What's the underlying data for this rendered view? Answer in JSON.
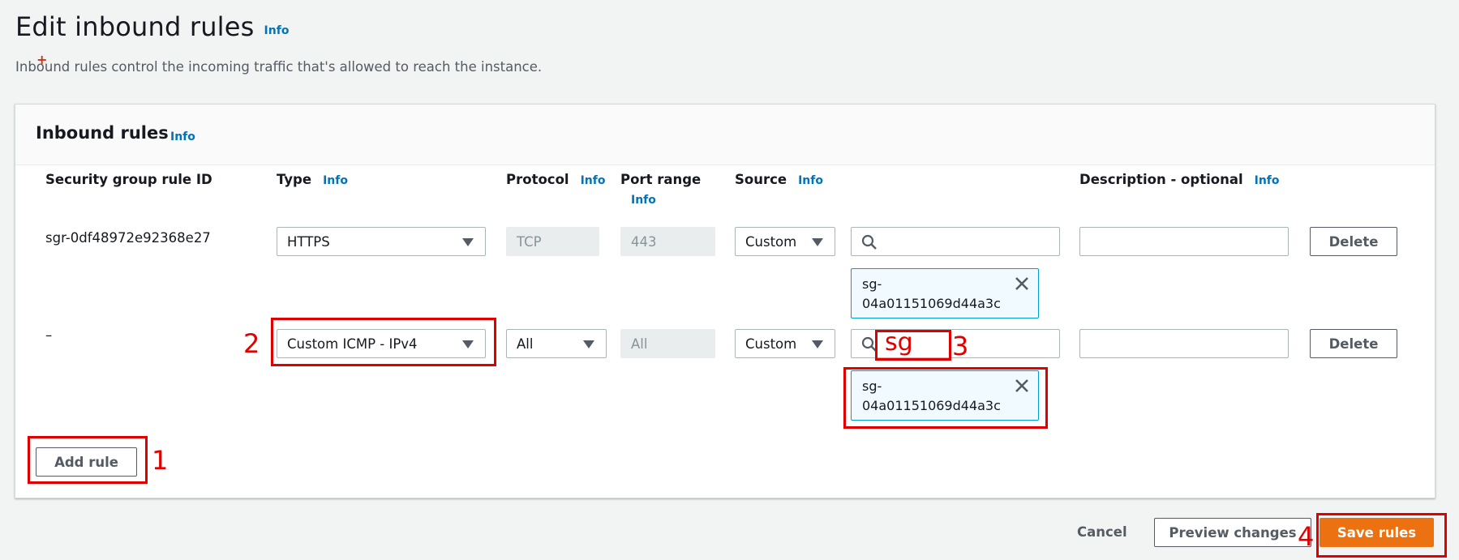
{
  "header": {
    "title": "Edit inbound rules",
    "info": "Info",
    "description": "Inbound rules control the incoming traffic that's allowed to reach the instance.",
    "desc_mark": "+"
  },
  "panel": {
    "title": "Inbound rules",
    "info": "Info",
    "columns": {
      "rule_id": "Security group rule ID",
      "type": "Type",
      "protocol": "Protocol",
      "port_range": "Port range",
      "source": "Source",
      "description": "Description - optional",
      "info": "Info"
    },
    "rows": [
      {
        "rule_id": "sgr-0df48972e92368e27",
        "type": "HTTPS",
        "protocol": "TCP",
        "port_range": "443",
        "source": "Custom",
        "search_value": "",
        "token_line1": "sg-",
        "token_line2": "04a01151069d44a3c",
        "description_value": "",
        "delete": "Delete"
      },
      {
        "rule_id": "–",
        "type": "Custom ICMP - IPv4",
        "protocol": "All",
        "port_range": "All",
        "source": "Custom",
        "search_value": "sg",
        "token_line1": "sg-",
        "token_line2": "04a01151069d44a3c",
        "description_value": "",
        "delete": "Delete"
      }
    ],
    "add_rule": "Add rule"
  },
  "footer": {
    "cancel": "Cancel",
    "preview": "Preview changes",
    "save": "Save rules"
  },
  "annotations": [
    "1",
    "2",
    "3",
    "4"
  ],
  "colors": {
    "accent": "#0073bb",
    "primary": "#ec7211",
    "annotation": "#e00000",
    "token_border": "#00a1c9"
  }
}
